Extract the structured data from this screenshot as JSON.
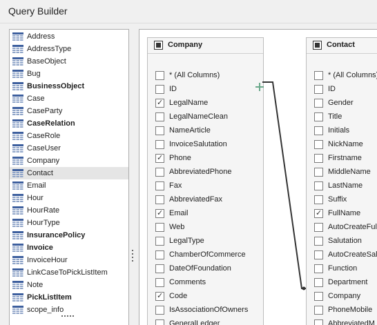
{
  "window": {
    "title": "Query Builder"
  },
  "table_list": {
    "items": [
      {
        "label": "Address",
        "bold": false,
        "selected": false
      },
      {
        "label": "AddressType",
        "bold": false,
        "selected": false
      },
      {
        "label": "BaseObject",
        "bold": false,
        "selected": false
      },
      {
        "label": "Bug",
        "bold": false,
        "selected": false
      },
      {
        "label": "BusinessObject",
        "bold": true,
        "selected": false
      },
      {
        "label": "Case",
        "bold": false,
        "selected": false
      },
      {
        "label": "CaseParty",
        "bold": false,
        "selected": false
      },
      {
        "label": "CaseRelation",
        "bold": true,
        "selected": false
      },
      {
        "label": "CaseRole",
        "bold": false,
        "selected": false
      },
      {
        "label": "CaseUser",
        "bold": false,
        "selected": false
      },
      {
        "label": "Company",
        "bold": false,
        "selected": false
      },
      {
        "label": "Contact",
        "bold": false,
        "selected": true
      },
      {
        "label": "Email",
        "bold": false,
        "selected": false
      },
      {
        "label": "Hour",
        "bold": false,
        "selected": false
      },
      {
        "label": "HourRate",
        "bold": false,
        "selected": false
      },
      {
        "label": "HourType",
        "bold": false,
        "selected": false
      },
      {
        "label": "InsurancePolicy",
        "bold": true,
        "selected": false
      },
      {
        "label": "Invoice",
        "bold": true,
        "selected": false
      },
      {
        "label": "InvoiceHour",
        "bold": false,
        "selected": false
      },
      {
        "label": "LinkCaseToPickListItem",
        "bold": false,
        "selected": false
      },
      {
        "label": "Note",
        "bold": false,
        "selected": false
      },
      {
        "label": "PickListItem",
        "bold": true,
        "selected": false
      },
      {
        "label": "scope_info",
        "bold": false,
        "selected": false
      }
    ]
  },
  "company_table": {
    "title": "Company",
    "columns": [
      {
        "label": "* (All Columns)",
        "checked": false
      },
      {
        "label": "ID",
        "checked": false
      },
      {
        "label": "LegalName",
        "checked": true
      },
      {
        "label": "LegalNameClean",
        "checked": false
      },
      {
        "label": "NameArticle",
        "checked": false
      },
      {
        "label": "InvoiceSalutation",
        "checked": false
      },
      {
        "label": "Phone",
        "checked": true
      },
      {
        "label": "AbbreviatedPhone",
        "checked": false
      },
      {
        "label": "Fax",
        "checked": false
      },
      {
        "label": "AbbreviatedFax",
        "checked": false
      },
      {
        "label": "Email",
        "checked": true
      },
      {
        "label": "Web",
        "checked": false
      },
      {
        "label": "LegalType",
        "checked": false
      },
      {
        "label": "ChamberOfCommerce",
        "checked": false
      },
      {
        "label": "DateOfFoundation",
        "checked": false
      },
      {
        "label": "Comments",
        "checked": false
      },
      {
        "label": "Code",
        "checked": true
      },
      {
        "label": "IsAssociationOfOwners",
        "checked": false
      },
      {
        "label": "GeneralLedger",
        "checked": false
      }
    ]
  },
  "contact_table": {
    "title": "Contact",
    "columns": [
      {
        "label": "* (All Columns)",
        "checked": false
      },
      {
        "label": "ID",
        "checked": false
      },
      {
        "label": "Gender",
        "checked": false
      },
      {
        "label": "Title",
        "checked": false
      },
      {
        "label": "Initials",
        "checked": false
      },
      {
        "label": "NickName",
        "checked": false
      },
      {
        "label": "Firstname",
        "checked": false
      },
      {
        "label": "MiddleName",
        "checked": false
      },
      {
        "label": "LastName",
        "checked": false
      },
      {
        "label": "Suffix",
        "checked": false
      },
      {
        "label": "FullName",
        "checked": true
      },
      {
        "label": "AutoCreateFul",
        "checked": false
      },
      {
        "label": "Salutation",
        "checked": false
      },
      {
        "label": "AutoCreateSal",
        "checked": false
      },
      {
        "label": "Function",
        "checked": false
      },
      {
        "label": "Department",
        "checked": false
      },
      {
        "label": "Company",
        "checked": false
      },
      {
        "label": "PhoneMobile",
        "checked": false
      },
      {
        "label": "AbbreviatedM",
        "checked": false
      }
    ]
  },
  "icons": {
    "table_icon": "table-grid-icon",
    "add_icon": "plus-icon",
    "checkmark": "✓"
  },
  "colors": {
    "selected_row": "#e5e5e5",
    "plus_icon": "#6aa88b",
    "table_icon": "#3d5f9e"
  }
}
